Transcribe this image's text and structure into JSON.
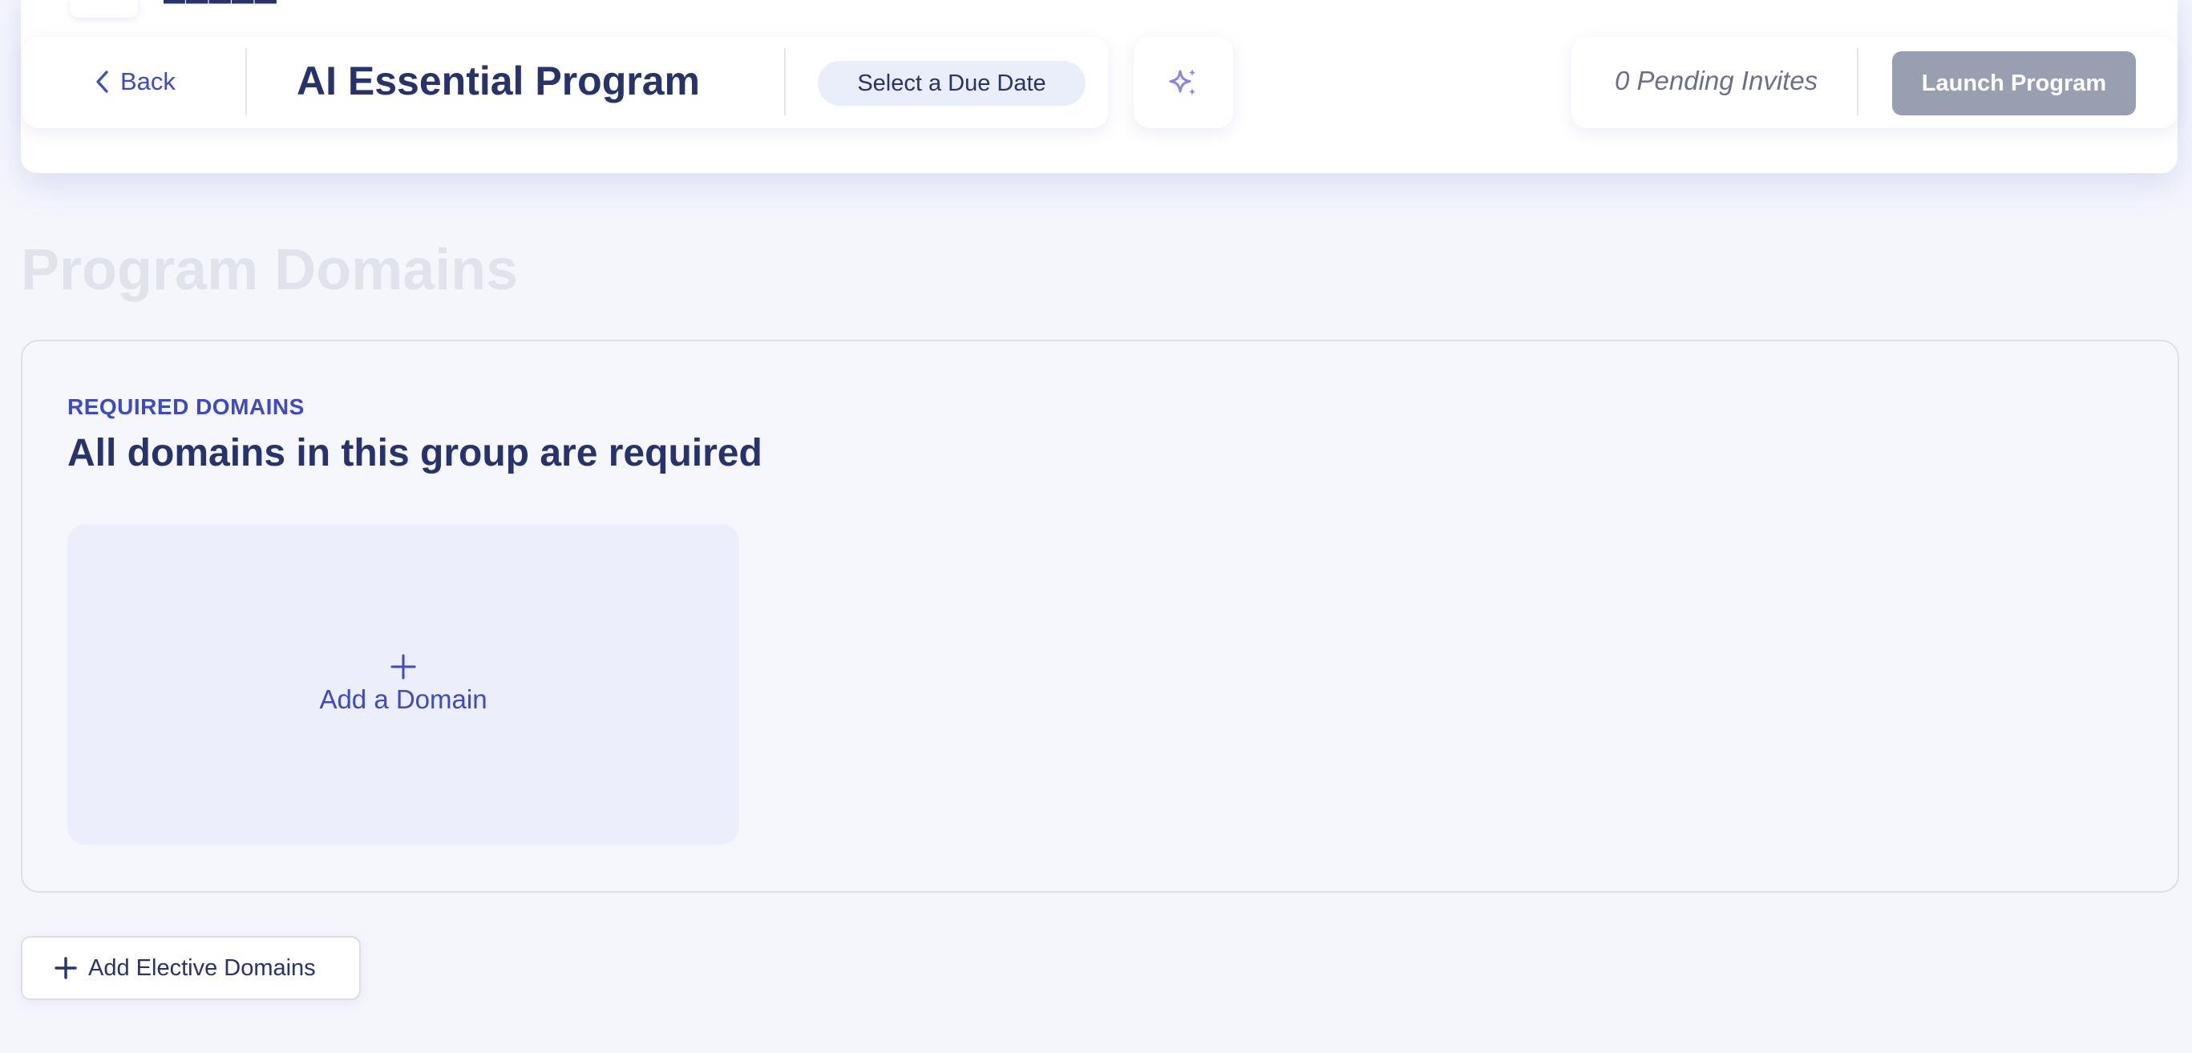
{
  "header": {
    "back_label": "Back",
    "program_title": "AI Essential Program",
    "due_date_label": "Select a Due Date",
    "sparkle_icon": "sparkle-icon",
    "pending_invites": "0 Pending Invites",
    "launch_label": "Launch Program"
  },
  "page": {
    "section_title": "Program Domains"
  },
  "required_group": {
    "label": "REQUIRED DOMAINS",
    "heading": "All domains in this group are required",
    "add_domain_label": "Add a Domain"
  },
  "elective": {
    "add_label": "Add Elective Domains"
  },
  "colors": {
    "accent": "#3e49c7",
    "navy": "#27336a",
    "launch_disabled": "#989fb0",
    "background": "#f5f6fc"
  }
}
